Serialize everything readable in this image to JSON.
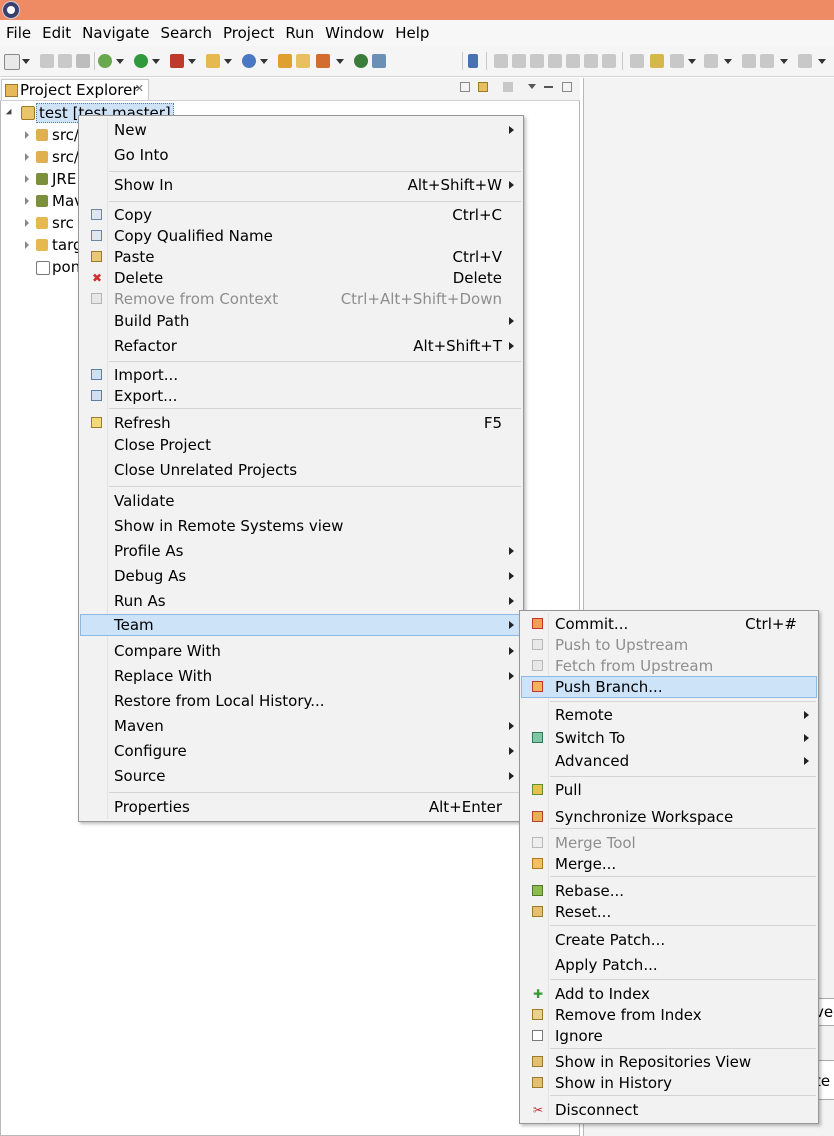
{
  "menubar": [
    "File",
    "Edit",
    "Navigate",
    "Search",
    "Project",
    "Run",
    "Window",
    "Help"
  ],
  "project_explorer": {
    "title": "Project Explorer",
    "close_glyph": "✕",
    "tree": [
      {
        "label": "test  [test master]",
        "selected": true
      },
      {
        "label": "src/"
      },
      {
        "label": "src/"
      },
      {
        "label": "JRE"
      },
      {
        "label": "Mav"
      },
      {
        "label": "src"
      },
      {
        "label": "targ"
      },
      {
        "label": "pon"
      }
    ]
  },
  "right_edge": {
    "a": "ve",
    "b": "te"
  },
  "context_menu": {
    "items": [
      {
        "label": "New",
        "submenu": true
      },
      {
        "label": "Go Into"
      },
      {
        "label": "Show In",
        "accel": "Alt+Shift+W",
        "submenu": true
      },
      {
        "label": "Copy",
        "accel": "Ctrl+C",
        "icon": "copy-icon"
      },
      {
        "label": "Copy Qualified Name",
        "icon": "copy-icon"
      },
      {
        "label": "Paste",
        "accel": "Ctrl+V",
        "icon": "paste-icon"
      },
      {
        "label": "Delete",
        "accel": "Delete",
        "icon": "delete-icon"
      },
      {
        "label": "Remove from Context",
        "accel": "Ctrl+Alt+Shift+Down",
        "disabled": true,
        "icon": "remove-context-icon"
      },
      {
        "label": "Build Path",
        "submenu": true
      },
      {
        "label": "Refactor",
        "accel": "Alt+Shift+T",
        "submenu": true
      },
      {
        "label": "Import...",
        "icon": "import-icon"
      },
      {
        "label": "Export...",
        "icon": "export-icon"
      },
      {
        "label": "Refresh",
        "accel": "F5",
        "icon": "refresh-icon"
      },
      {
        "label": "Close Project"
      },
      {
        "label": "Close Unrelated Projects"
      },
      {
        "label": "Validate"
      },
      {
        "label": "Show in Remote Systems view"
      },
      {
        "label": "Profile As",
        "submenu": true
      },
      {
        "label": "Debug As",
        "submenu": true
      },
      {
        "label": "Run As",
        "submenu": true
      },
      {
        "label": "Team",
        "submenu": true,
        "highlighted": true
      },
      {
        "label": "Compare With",
        "submenu": true
      },
      {
        "label": "Replace With",
        "submenu": true
      },
      {
        "label": "Restore from Local History..."
      },
      {
        "label": "Maven",
        "submenu": true
      },
      {
        "label": "Configure",
        "submenu": true
      },
      {
        "label": "Source",
        "submenu": true
      },
      {
        "label": "Properties",
        "accel": "Alt+Enter"
      }
    ]
  },
  "team_menu": {
    "items": [
      {
        "label": "Commit...",
        "accel": "Ctrl+#",
        "icon": "commit-icon"
      },
      {
        "label": "Push to Upstream",
        "disabled": true,
        "icon": "push-upstream-icon"
      },
      {
        "label": "Fetch from Upstream",
        "disabled": true,
        "icon": "fetch-upstream-icon"
      },
      {
        "label": "Push Branch...",
        "highlighted": true,
        "icon": "push-branch-icon"
      },
      {
        "label": "Remote",
        "submenu": true
      },
      {
        "label": "Switch To",
        "submenu": true,
        "icon": "switch-icon"
      },
      {
        "label": "Advanced",
        "submenu": true
      },
      {
        "label": "Pull",
        "icon": "pull-icon"
      },
      {
        "label": "Synchronize Workspace",
        "icon": "synchronize-icon"
      },
      {
        "label": "Merge Tool",
        "disabled": true,
        "icon": "merge-tool-icon"
      },
      {
        "label": "Merge...",
        "icon": "merge-icon"
      },
      {
        "label": "Rebase...",
        "icon": "rebase-icon"
      },
      {
        "label": "Reset...",
        "icon": "reset-icon"
      },
      {
        "label": "Create Patch..."
      },
      {
        "label": "Apply Patch..."
      },
      {
        "label": "Add to Index",
        "icon": "add-index-icon"
      },
      {
        "label": "Remove from Index",
        "icon": "remove-index-icon"
      },
      {
        "label": "Ignore",
        "icon": "ignore-icon"
      },
      {
        "label": "Show in Repositories View",
        "icon": "repositories-icon"
      },
      {
        "label": "Show in History",
        "icon": "history-icon"
      },
      {
        "label": "Disconnect",
        "icon": "disconnect-icon"
      }
    ]
  }
}
